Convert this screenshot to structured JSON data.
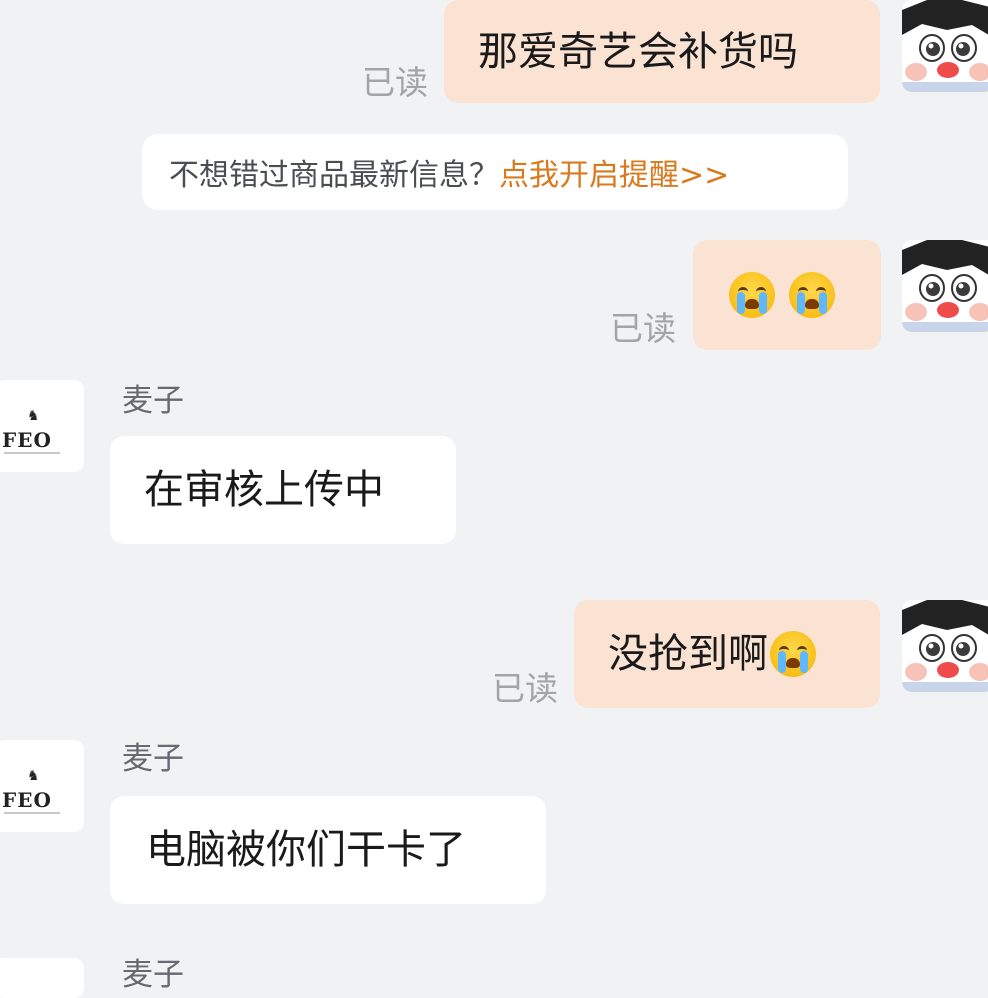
{
  "messages": [
    {
      "from": "me",
      "text": "那爱奇艺会补货吗",
      "read_label": "已读"
    },
    {
      "from": "me",
      "emoji": [
        "loudly-crying-face",
        "loudly-crying-face"
      ],
      "read_label": "已读"
    },
    {
      "from": "shop",
      "sender": "麦子",
      "text": "在审核上传中"
    },
    {
      "from": "me",
      "text": "没抢到啊",
      "emoji": [
        "loudly-crying-face"
      ],
      "read_label": "已读"
    },
    {
      "from": "shop",
      "sender": "麦子",
      "text": "电脑被你们干卡了"
    },
    {
      "from": "shop",
      "sender": "麦子"
    }
  ],
  "notice": {
    "text": "不想错过商品最新信息？",
    "link": "点我开启提醒>>"
  },
  "shop_avatar": {
    "logo_text": "FEO"
  },
  "colors": {
    "background": "#f1f2f4",
    "my_bubble": "#fbe3d4",
    "their_bubble": "#ffffff",
    "link": "#d97a1f",
    "read": "#a2a4a8"
  }
}
